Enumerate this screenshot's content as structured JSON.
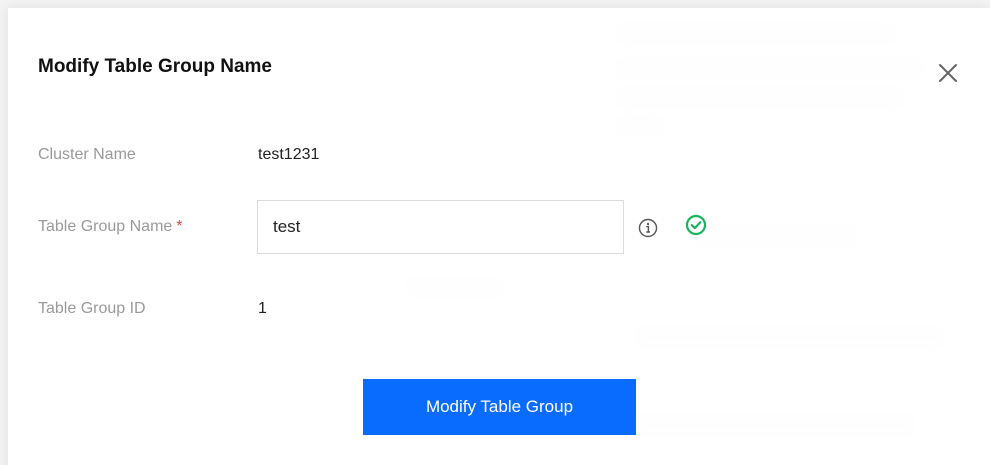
{
  "dialog": {
    "title": "Modify Table Group Name",
    "close_icon": "close-icon"
  },
  "form": {
    "cluster_name_label": "Cluster Name",
    "cluster_name_value": "test1231",
    "table_group_name_label": "Table Group Name",
    "required_mark": "*",
    "table_group_name_value": "test",
    "info_icon": "info-icon",
    "valid_icon": "check-circle-icon",
    "table_group_id_label": "Table Group ID",
    "table_group_id_value": "1"
  },
  "actions": {
    "submit_label": "Modify Table Group"
  },
  "colors": {
    "primary": "#0a6cff",
    "success": "#18b35c",
    "required": "#e54545"
  }
}
